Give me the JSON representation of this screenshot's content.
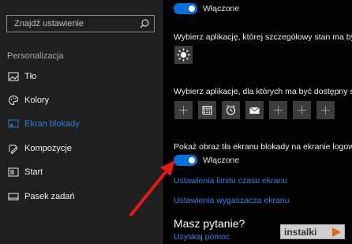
{
  "search": {
    "placeholder": "Znajdź ustawienie"
  },
  "sidebar": {
    "section_title": "Personalizacja",
    "items": [
      {
        "label": "Tło",
        "icon": "picture-icon",
        "active": false
      },
      {
        "label": "Kolory",
        "icon": "palette-icon",
        "active": false
      },
      {
        "label": "Ekran blokady",
        "icon": "lock-screen-icon",
        "active": true
      },
      {
        "label": "Kompozycje",
        "icon": "brush-icon",
        "active": false
      },
      {
        "label": "Start",
        "icon": "start-icon",
        "active": false
      },
      {
        "label": "Pasek zadań",
        "icon": "taskbar-icon",
        "active": false
      }
    ]
  },
  "main": {
    "top_toggle_label": "Włączone",
    "detailed_status_text": "Wybierz aplikację, której szczegółowy stan ma być wy",
    "quick_status_text": "Wybierz aplikacje, dla których ma być dostępny szybk",
    "quick_tiles": [
      "plus-icon",
      "calendar-icon",
      "alarm-icon",
      "mail-icon",
      "plus-icon",
      "plus-icon",
      "plus-icon"
    ],
    "signin_bg_text": "Pokaż obraz tła ekranu blokady na ekranie logowania",
    "signin_toggle_label": "Włączone",
    "signin_toggle_on": true,
    "screen_timeout_link": "Ustawienia limitu czasu ekranu",
    "screensaver_link": "Ustawienia wygaszacza ekranu",
    "question_heading": "Masz pytanie?",
    "help_link": "Uzyskaj pomoc"
  },
  "watermark": {
    "text": "instalki"
  },
  "colors": {
    "accent": "#0a6fd6",
    "link": "#2d86e6",
    "sidebar_bg": "#1f1f1f",
    "main_bg": "#000000",
    "arrow": "#e01b1b"
  }
}
